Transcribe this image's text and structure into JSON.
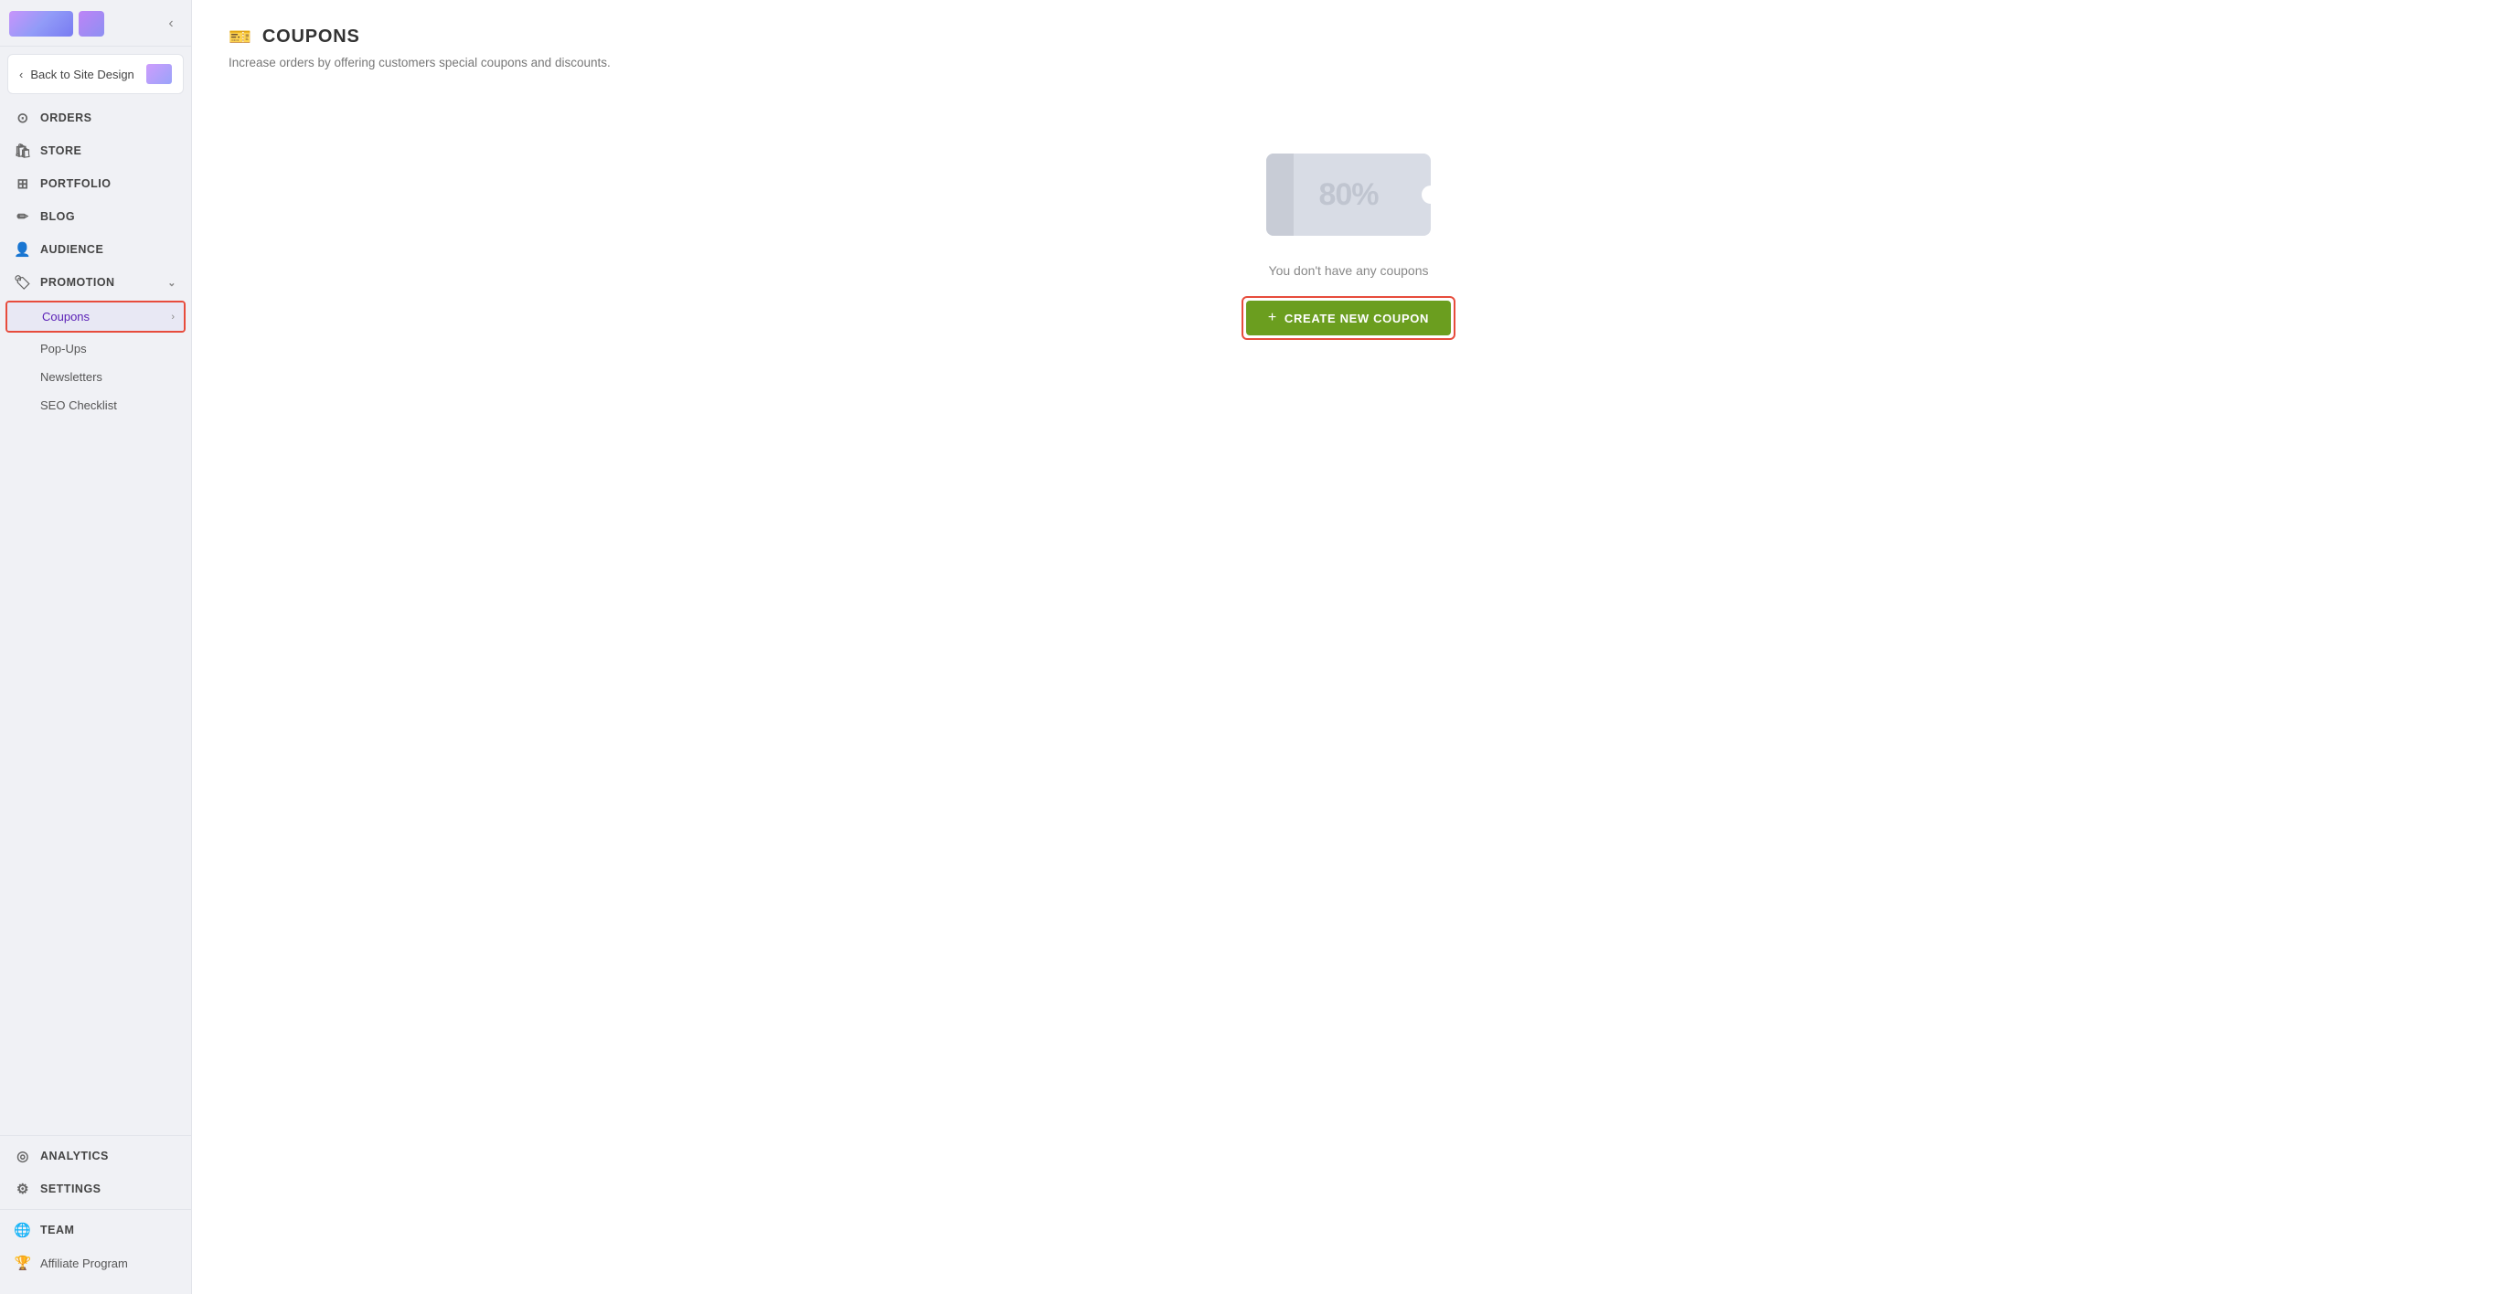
{
  "sidebar": {
    "collapse_label": "Collapse sidebar",
    "back_to_site": "Back to Site Design",
    "nav_items": [
      {
        "id": "orders",
        "label": "Orders",
        "icon": "⊙"
      },
      {
        "id": "store",
        "label": "Store",
        "icon": "🏪"
      },
      {
        "id": "portfolio",
        "label": "Portfolio",
        "icon": "⊞"
      },
      {
        "id": "blog",
        "label": "Blog",
        "icon": "✎"
      },
      {
        "id": "audience",
        "label": "Audience",
        "icon": "👤"
      },
      {
        "id": "promotion",
        "label": "Promotion",
        "icon": "🏷",
        "expanded": true
      }
    ],
    "promotion_sub_items": [
      {
        "id": "coupons",
        "label": "Coupons",
        "active": true
      },
      {
        "id": "popups",
        "label": "Pop-Ups",
        "active": false
      },
      {
        "id": "newsletters",
        "label": "Newsletters",
        "active": false
      },
      {
        "id": "seo-checklist",
        "label": "SEO Checklist",
        "active": false
      }
    ],
    "bottom_items": [
      {
        "id": "analytics",
        "label": "Analytics",
        "icon": "◎"
      },
      {
        "id": "settings",
        "label": "Settings",
        "icon": "⚙"
      },
      {
        "id": "team",
        "label": "Team",
        "icon": "🌐"
      }
    ],
    "affiliate_label": "Affiliate Program"
  },
  "page": {
    "icon": "🎫",
    "title": "Coupons",
    "subtitle": "Increase orders by offering customers special coupons and discounts.",
    "empty_state": {
      "coupon_text": "80%",
      "message": "You don't have any coupons",
      "create_button_label": "CREATE NEW COUPON",
      "create_button_plus": "+"
    }
  }
}
